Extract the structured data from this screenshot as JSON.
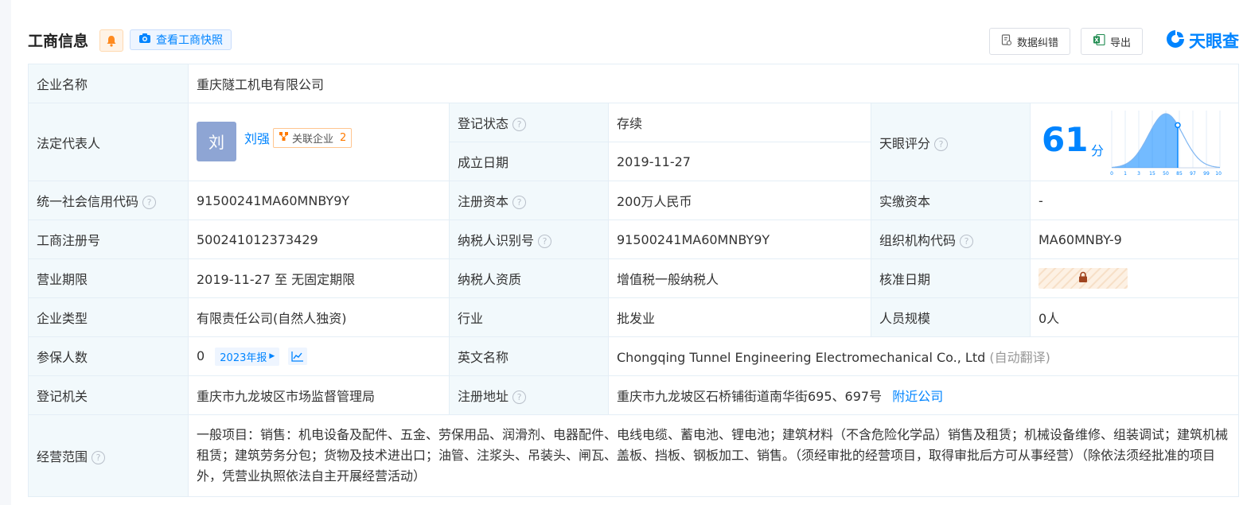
{
  "header": {
    "title": "工商信息",
    "snapshot_button": "查看工商快照",
    "correction_button": "数据纠错",
    "export_button": "导出",
    "brand": "天眼查"
  },
  "company": {
    "name_label": "企业名称",
    "name": "重庆隧工机电有限公司",
    "legal_rep_label": "法定代表人",
    "legal_rep_avatar": "刘",
    "legal_rep_name": "刘强",
    "related_label": "关联企业",
    "related_count": "2",
    "reg_status_label": "登记状态",
    "reg_status": "存续",
    "founded_label": "成立日期",
    "founded": "2019-11-27",
    "score_label": "天眼评分",
    "score": "61",
    "score_unit": "分",
    "credit_code_label": "统一社会信用代码",
    "credit_code": "91500241MA60MNBY9Y",
    "reg_capital_label": "注册资本",
    "reg_capital": "200万人民币",
    "paid_capital_label": "实缴资本",
    "paid_capital": "-",
    "biz_reg_no_label": "工商注册号",
    "biz_reg_no": "500241012373429",
    "taxpayer_id_label": "纳税人识别号",
    "taxpayer_id": "91500241MA60MNBY9Y",
    "org_code_label": "组织机构代码",
    "org_code": "MA60MNBY-9",
    "term_label": "营业期限",
    "term": "2019-11-27 至 无固定期限",
    "taxpayer_qual_label": "纳税人资质",
    "taxpayer_qual": "增值税一般纳税人",
    "approval_date_label": "核准日期",
    "type_label": "企业类型",
    "type": "有限责任公司(自然人独资)",
    "industry_label": "行业",
    "industry": "批发业",
    "staff_label": "人员规模",
    "staff": "0人",
    "insured_label": "参保人数",
    "insured": "0",
    "insured_year": "2023年报",
    "english_name_label": "英文名称",
    "english_name": "Chongqing Tunnel Engineering Electromechanical Co., Ltd",
    "english_name_note": "(自动翻译)",
    "authority_label": "登记机关",
    "authority": "重庆市九龙坡区市场监督管理局",
    "address_label": "注册地址",
    "address": "重庆市九龙坡区石桥铺街道南华街695、697号",
    "nearby_link": "附近公司",
    "scope_label": "经营范围",
    "scope": "一般项目：销售：机电设备及配件、五金、劳保用品、润滑剂、电器配件、电线电缆、蓄电池、锂电池；建筑材料（不含危险化学品）销售及租赁；机械设备维修、组装调试；建筑机械租赁；建筑劳务分包；货物及技术进出口；油管、注浆头、吊装头、闸瓦、盖板、挡板、钢板加工、销售。（须经审批的经营项目，取得审批后方可从事经营）（除依法须经批准的项目外，凭营业执照依法自主开展经营活动）"
  },
  "score_chart": {
    "x_ticks": [
      "0",
      "1",
      "3",
      "15",
      "50",
      "85",
      "97",
      "99",
      "100"
    ],
    "marker_percent": 61,
    "color": "#0084ff"
  }
}
